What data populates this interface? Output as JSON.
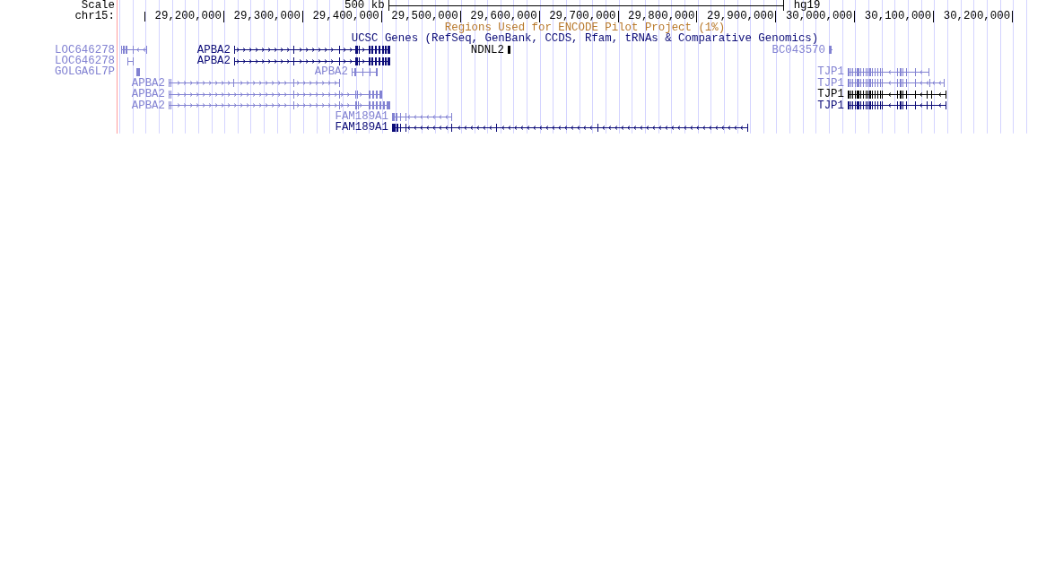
{
  "scale": {
    "label": "Scale",
    "length": "500 kb",
    "assembly": "hg19"
  },
  "ruler": {
    "chromosome": "chr15:",
    "ticks": [
      "29,200,000",
      "29,300,000",
      "29,400,000",
      "29,500,000",
      "29,600,000",
      "29,700,000",
      "29,800,000",
      "29,900,000",
      "30,000,000",
      "30,100,000",
      "30,200,000"
    ]
  },
  "tracks": [
    {
      "title": "Regions Used for ENCODE Pilot Project (1%)",
      "color": "#b8782a"
    },
    {
      "title": "UCSC Genes (RefSeq, GenBank, CCDS, Rfam, tRNAs & Comparative Genomics)",
      "color": "#0c0c78",
      "rows": [
        {
          "genes": [
            {
              "name": "LOC646278",
              "color": "#8282d2",
              "kind": "margin"
            },
            {
              "name": "APBA2",
              "color": "#0c0c78",
              "kind": "inline"
            },
            {
              "name": "NDNL2",
              "color": "#000000",
              "kind": "inline"
            },
            {
              "name": "BC043570",
              "color": "#8282d2",
              "kind": "inline"
            }
          ]
        },
        {
          "genes": [
            {
              "name": "LOC646278",
              "color": "#8282d2",
              "kind": "margin"
            },
            {
              "name": "APBA2",
              "color": "#0c0c78",
              "kind": "inline"
            }
          ]
        },
        {
          "genes": [
            {
              "name": "GOLGA6L7P",
              "color": "#8282d2",
              "kind": "margin"
            },
            {
              "name": "APBA2",
              "color": "#8282d2",
              "kind": "inline"
            },
            {
              "name": "TJP1",
              "color": "#8282d2",
              "kind": "inline"
            }
          ]
        },
        {
          "genes": [
            {
              "name": "APBA2",
              "color": "#8282d2",
              "kind": "inline"
            },
            {
              "name": "TJP1",
              "color": "#8282d2",
              "kind": "inline"
            }
          ]
        },
        {
          "genes": [
            {
              "name": "APBA2",
              "color": "#8282d2",
              "kind": "inline"
            },
            {
              "name": "TJP1",
              "color": "#000000",
              "kind": "inline"
            }
          ]
        },
        {
          "genes": [
            {
              "name": "APBA2",
              "color": "#8282d2",
              "kind": "inline"
            },
            {
              "name": "TJP1",
              "color": "#0c0c78",
              "kind": "inline"
            }
          ]
        },
        {
          "genes": [
            {
              "name": "FAM189A1",
              "color": "#8282d2",
              "kind": "inline"
            }
          ]
        },
        {
          "genes": [
            {
              "name": "FAM189A1",
              "color": "#0c0c78",
              "kind": "inline"
            }
          ]
        }
      ]
    }
  ]
}
